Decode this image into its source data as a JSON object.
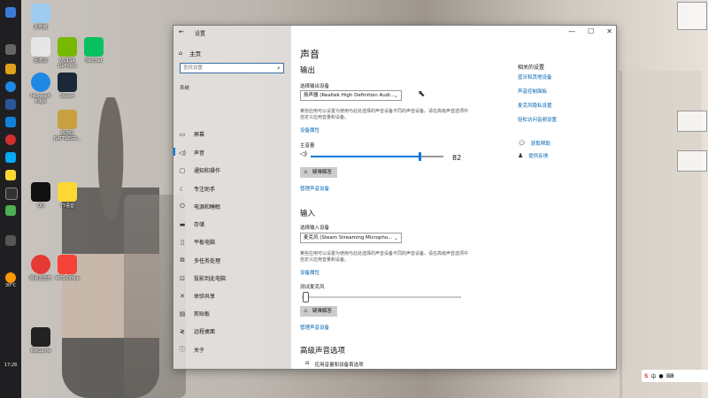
{
  "window": {
    "title": "设置",
    "back_glyph": "←",
    "controls": [
      "—",
      "☐",
      "✕"
    ]
  },
  "sidebar": {
    "home": "主页",
    "search_placeholder": "查找设置",
    "section": "系统",
    "items": [
      {
        "label": "屏幕",
        "icon": "monitor-icon"
      },
      {
        "label": "声音",
        "icon": "speaker-icon",
        "active": true
      },
      {
        "label": "通知和操作",
        "icon": "notification-icon"
      },
      {
        "label": "专注助手",
        "icon": "moon-icon"
      },
      {
        "label": "电源和睡眠",
        "icon": "power-icon"
      },
      {
        "label": "存储",
        "icon": "storage-icon"
      },
      {
        "label": "平板电脑",
        "icon": "tablet-icon"
      },
      {
        "label": "多任务处理",
        "icon": "multitask-icon"
      },
      {
        "label": "投影到此电脑",
        "icon": "project-icon"
      },
      {
        "label": "体验共享",
        "icon": "share-icon"
      },
      {
        "label": "剪贴板",
        "icon": "clipboard-icon"
      },
      {
        "label": "远程桌面",
        "icon": "remote-icon"
      },
      {
        "label": "关于",
        "icon": "info-icon"
      }
    ]
  },
  "main": {
    "title": "声音",
    "output": {
      "heading": "输出",
      "select_label": "选择输出设备",
      "device": "扬声器 (Realtek High Definition Audi...",
      "desc": "某些应用可以设置为使用与此处选择的声音设备不同的声音设备。请在高级声音选项中自定义应用音量和设备。",
      "properties_link": "设备属性",
      "volume_label": "主音量",
      "volume_value": "82",
      "volume_level": 0.82,
      "troubleshoot": "疑难解答",
      "manage_link": "管理声音设备"
    },
    "input": {
      "heading": "输入",
      "select_label": "选择输入设备",
      "device": "麦克风 (Steam Streaming Micropho...",
      "desc": "某些应用可以设置为使用与此处选择的声音设备不同的声音设备。请在高级声音选项中自定义应用音量和设备。",
      "properties_link": "设备属性",
      "test_label": "测试麦克风",
      "troubleshoot": "疑难解答",
      "manage_link": "管理声音设备"
    },
    "advanced": {
      "heading": "高级声音选项",
      "item": "应用音量和设备首选项"
    }
  },
  "related": {
    "title": "相关的设置",
    "links": [
      "蓝牙和其他设备",
      "声音控制面板",
      "麦克风隐私设置",
      "轻松访问音频设置"
    ],
    "help": "获取帮助",
    "feedback": "提供反馈"
  },
  "desktop": {
    "icons": [
      {
        "label": "此电脑"
      },
      {
        "label": "Microsoft\nEdge"
      },
      {
        "label": "回收站"
      },
      {
        "label": "NVIDIA\nGeForce"
      },
      {
        "label": "Steam"
      },
      {
        "label": "WeChat"
      },
      {
        "label": "PUBG\nBATTLEGR..."
      },
      {
        "label": "QQ"
      },
      {
        "label": "YY语音"
      },
      {
        "label": "网易云音乐"
      },
      {
        "label": "WPS Office"
      },
      {
        "label": "WeGame"
      }
    ]
  },
  "taskbar": {
    "weather": "30°C",
    "time": "17:28"
  },
  "tray": {
    "ime": "S",
    "lang": "中"
  }
}
